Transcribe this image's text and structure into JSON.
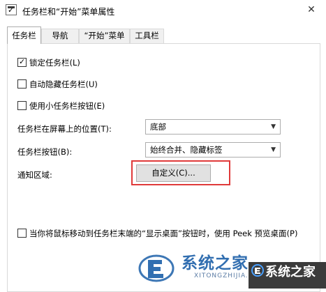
{
  "window": {
    "title": "任务栏和“开始”菜单属性",
    "close_glyph": "✕"
  },
  "tabs": [
    {
      "label": "任务栏",
      "active": true
    },
    {
      "label": "导航",
      "active": false
    },
    {
      "label": "“开始”菜单",
      "active": false
    },
    {
      "label": "工具栏",
      "active": false
    }
  ],
  "options": {
    "lock_taskbar": {
      "label": "锁定任务栏(L)",
      "checked": true
    },
    "auto_hide": {
      "label": "自动隐藏任务栏(U)",
      "checked": false
    },
    "small_buttons": {
      "label": "使用小任务栏按钮(E)",
      "checked": false
    }
  },
  "position": {
    "label": "任务栏在屏幕上的位置(T):",
    "value": "底部"
  },
  "buttons_mode": {
    "label": "任务栏按钮(B):",
    "value": "始终合并、隐藏标签"
  },
  "notification": {
    "label": "通知区域:",
    "button_label": "自定义(C)..."
  },
  "peek": {
    "label": "当你将鼠标移动到任务栏末端的“显示桌面”按钮时，使用 Peek 预览桌面(P)",
    "checked": false
  },
  "watermark": {
    "left_text": "系统之家",
    "sub_text": "XITONGZHIJIA.NET",
    "right_text": "系统之家"
  },
  "icons": {
    "window_icon": "taskbar-properties-icon",
    "dropdown_arrow": "▼"
  },
  "colors": {
    "highlight": "#e03a3a",
    "watermark_blue": "#1b5fa8"
  }
}
